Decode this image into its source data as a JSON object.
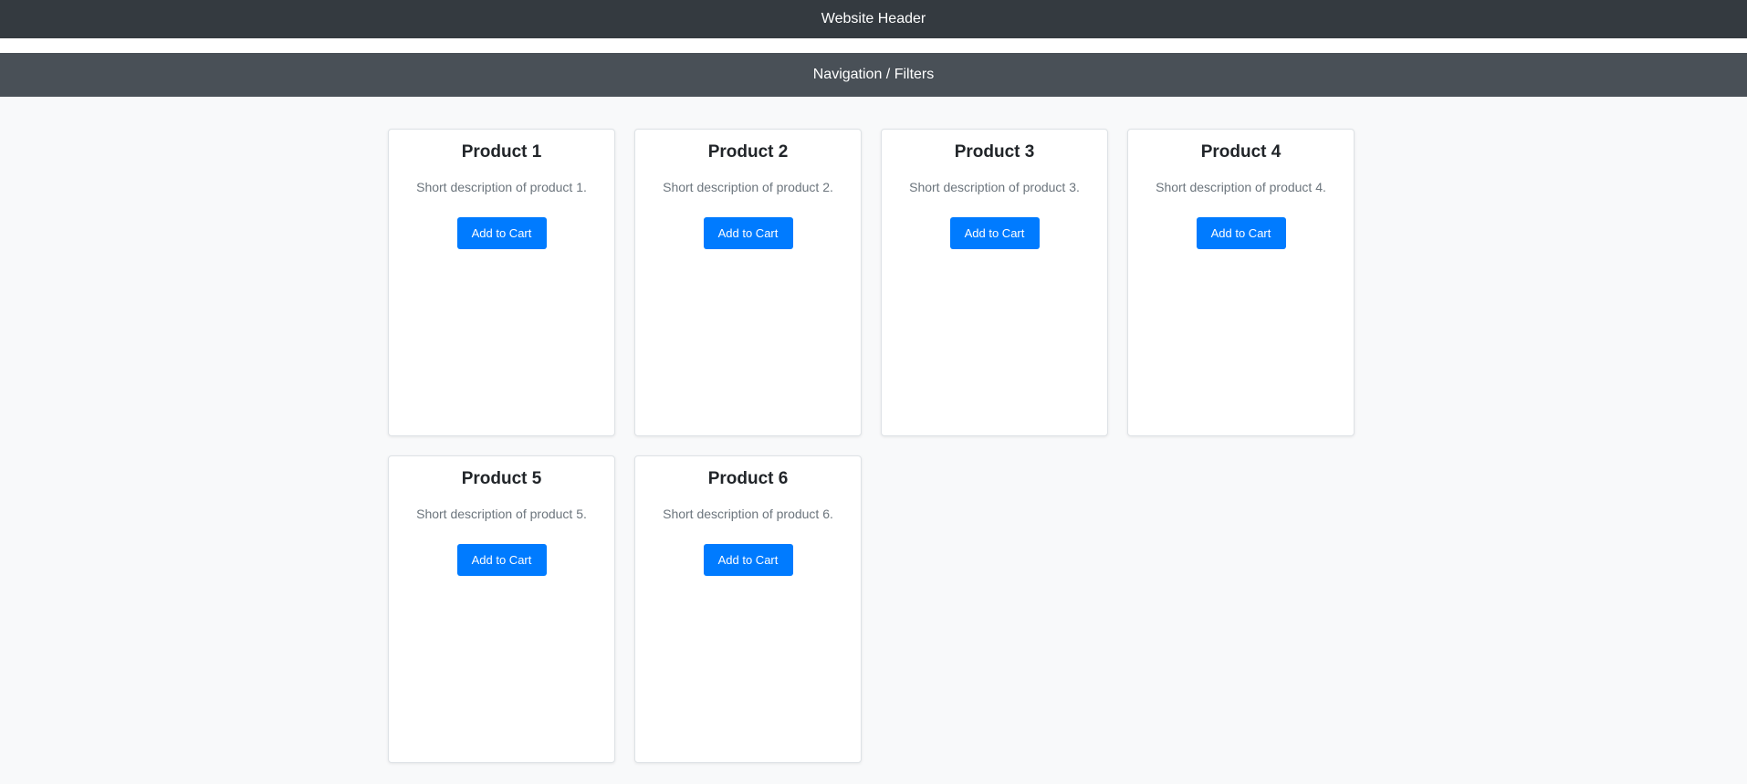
{
  "header": {
    "title": "Website Header"
  },
  "nav": {
    "label": "Navigation / Filters"
  },
  "colors": {
    "header_bg": "#343a40",
    "nav_bg": "#495057",
    "page_bg": "#f8f9fa",
    "button_bg": "#007bff"
  },
  "products": [
    {
      "title": "Product 1",
      "description": "Short description of product 1.",
      "button_label": "Add to Cart"
    },
    {
      "title": "Product 2",
      "description": "Short description of product 2.",
      "button_label": "Add to Cart"
    },
    {
      "title": "Product 3",
      "description": "Short description of product 3.",
      "button_label": "Add to Cart"
    },
    {
      "title": "Product 4",
      "description": "Short description of product 4.",
      "button_label": "Add to Cart"
    },
    {
      "title": "Product 5",
      "description": "Short description of product 5.",
      "button_label": "Add to Cart"
    },
    {
      "title": "Product 6",
      "description": "Short description of product 6.",
      "button_label": "Add to Cart"
    }
  ]
}
